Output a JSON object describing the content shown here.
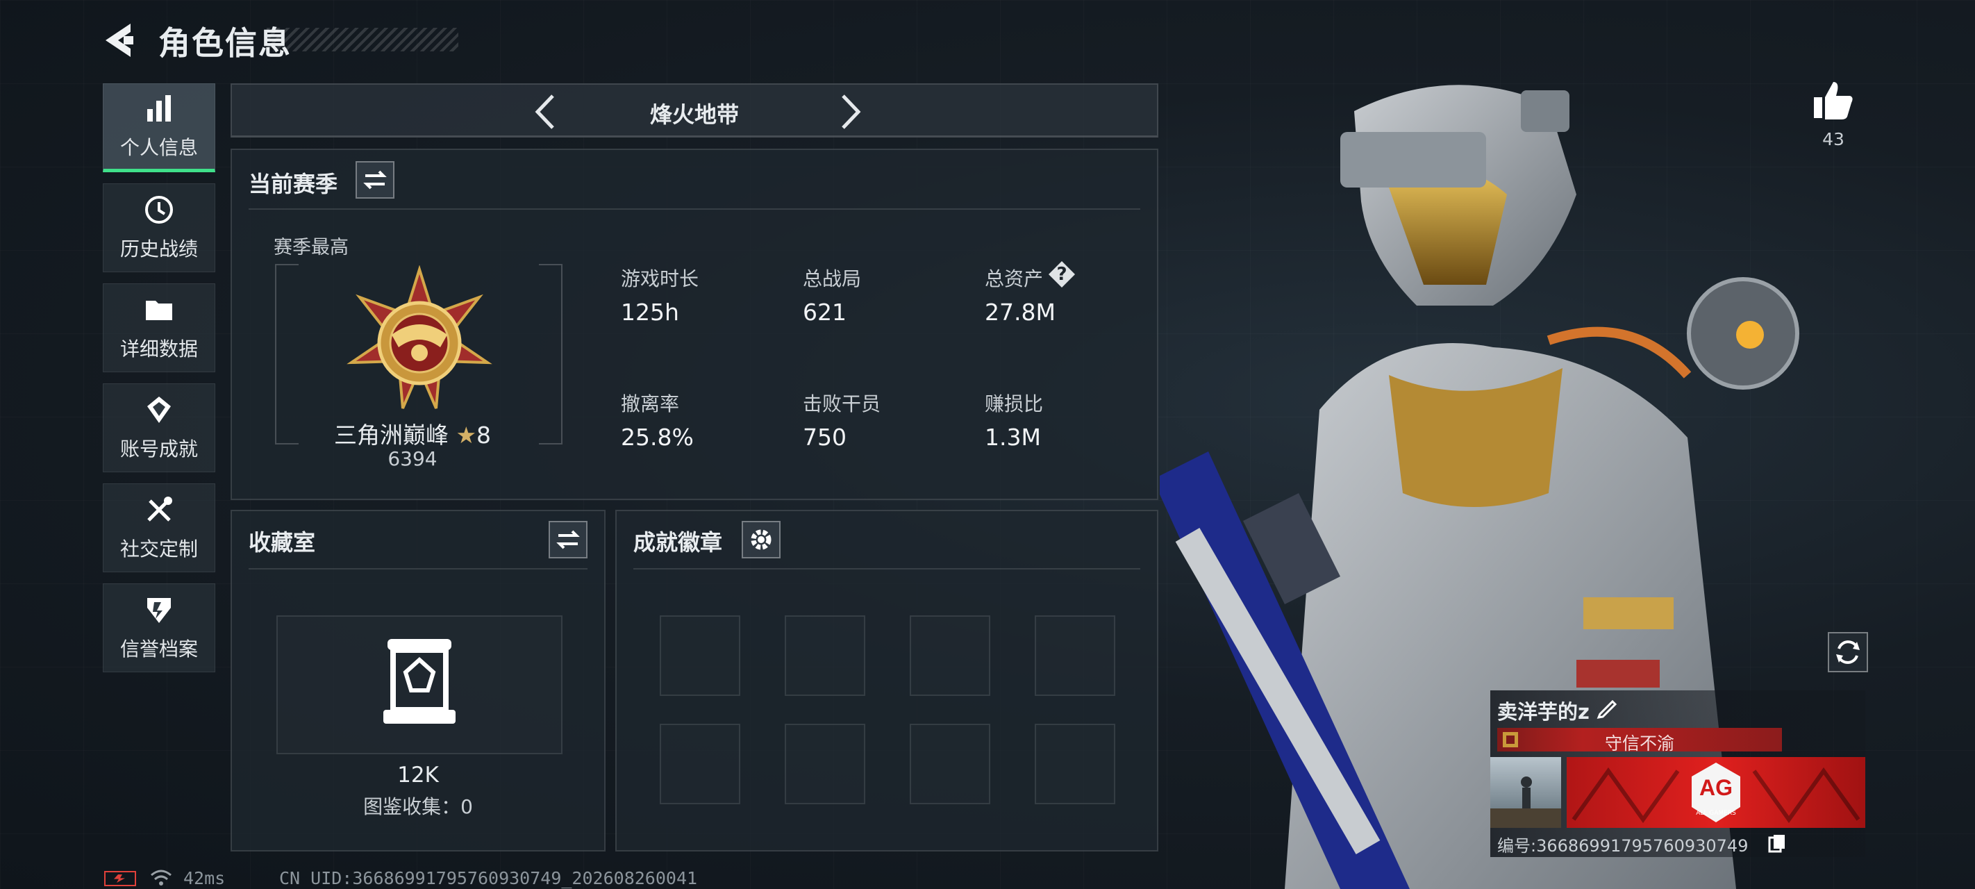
{
  "header": {
    "title": "角色信息"
  },
  "sidebar": {
    "items": [
      {
        "label": "个人信息",
        "icon": "bar-chart-icon",
        "active": true
      },
      {
        "label": "历史战绩",
        "icon": "history-icon"
      },
      {
        "label": "详细数据",
        "icon": "folder-icon"
      },
      {
        "label": "账号成就",
        "icon": "achievement-icon"
      },
      {
        "label": "社交定制",
        "icon": "tools-icon"
      },
      {
        "label": "信誉档案",
        "icon": "credit-shield-icon"
      }
    ]
  },
  "mode_selector": {
    "label": "烽火地带"
  },
  "season": {
    "title": "当前赛季",
    "highest_label": "赛季最高",
    "rank_name": "三角洲巅峰",
    "rank_stars": "8",
    "rank_score": "6394",
    "stats": [
      {
        "label": "游戏时长",
        "value": "125h"
      },
      {
        "label": "总战局",
        "value": "621"
      },
      {
        "label": "总资产",
        "value": "27.8M",
        "help": "?"
      },
      {
        "label": "撤离率",
        "value": "25.8%"
      },
      {
        "label": "击败干员",
        "value": "750"
      },
      {
        "label": "赚损比",
        "value": "1.3M"
      }
    ]
  },
  "collection": {
    "title": "收藏室",
    "value": "12K",
    "caption": "图鉴收集：0"
  },
  "achievements": {
    "title": "成就徽章",
    "slots": 8
  },
  "likes": {
    "count": "43"
  },
  "player": {
    "name": "卖洋芋的z",
    "credit_title": "守信不渝",
    "banner_logo": "AG",
    "banner_subtitle": "ALL GAMERS",
    "id_text": "编号:36686991795760930749"
  },
  "status_bar": {
    "ping": "42ms",
    "uid": "CN UID:36686991795760930749_202608260041"
  },
  "colors": {
    "accent_green": "#3fe08a",
    "credit_red": "#b3201f",
    "gold": "#c99a3a"
  }
}
